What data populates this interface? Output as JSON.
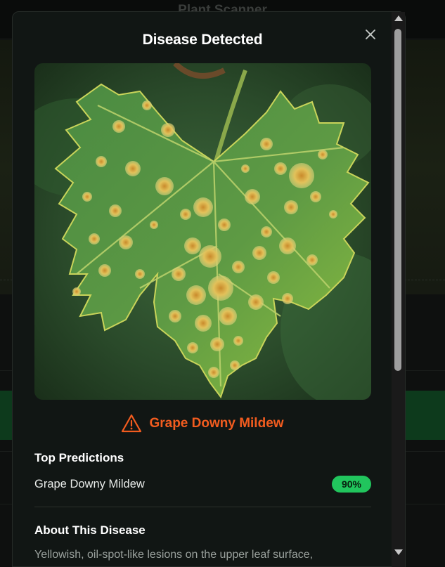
{
  "background": {
    "app_title": "Plant Scanner"
  },
  "modal": {
    "title": "Disease Detected",
    "close_icon": "close-icon",
    "image_icon": "leaf-photo",
    "result": {
      "icon": "warning-triangle-icon",
      "disease": "Grape Downy Mildew",
      "color": "#f25c1f"
    },
    "predictions": {
      "heading": "Top Predictions",
      "items": [
        {
          "name": "Grape Downy Mildew",
          "confidence": "90%"
        }
      ],
      "badge_color": "#21c55d"
    },
    "about": {
      "heading": "About This Disease",
      "text": "Yellowish, oil-spot-like lesions on the upper leaf surface,"
    }
  },
  "colors": {
    "modal_bg": "#111614",
    "accent_green": "#21c55d",
    "warning": "#f25c1f"
  }
}
